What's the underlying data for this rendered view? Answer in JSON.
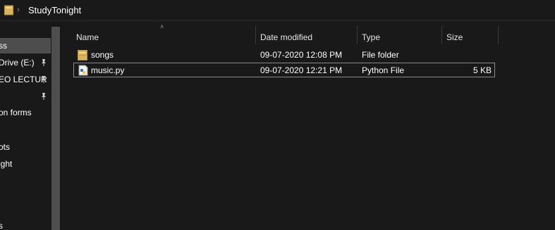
{
  "address": {
    "path": "StudyTonight"
  },
  "nav": {
    "items": [
      {
        "label": "ss",
        "pinned": false,
        "selected": true
      },
      {
        "label": "Drive (E:)",
        "pinned": true,
        "selected": false
      },
      {
        "label": "EO LECTUR",
        "pinned": true,
        "selected": false
      },
      {
        "label": "",
        "pinned": true,
        "selected": false
      },
      {
        "label": "on forms",
        "pinned": false,
        "selected": false
      },
      {
        "label": "",
        "pinned": false,
        "selected": false
      },
      {
        "label": "ots",
        "pinned": false,
        "selected": false
      },
      {
        "label": "ight",
        "pinned": false,
        "selected": false
      },
      {
        "label": "s",
        "pinned": false,
        "selected": false
      }
    ]
  },
  "columns": {
    "name": "Name",
    "date": "Date modified",
    "type": "Type",
    "size": "Size"
  },
  "files": [
    {
      "name": "songs",
      "date": "09-07-2020 12:08 PM",
      "type": "File folder",
      "size": "",
      "icon": "folder-icon"
    },
    {
      "name": "music.py",
      "date": "09-07-2020 12:21 PM",
      "type": "Python File",
      "size": "5 KB",
      "icon": "python-file-icon"
    }
  ],
  "colors": {
    "background": "#191919",
    "nav_selected": "#4d4d4d",
    "scrollbar_thumb": "#4e4e4e",
    "folder": "#dcb35a"
  }
}
